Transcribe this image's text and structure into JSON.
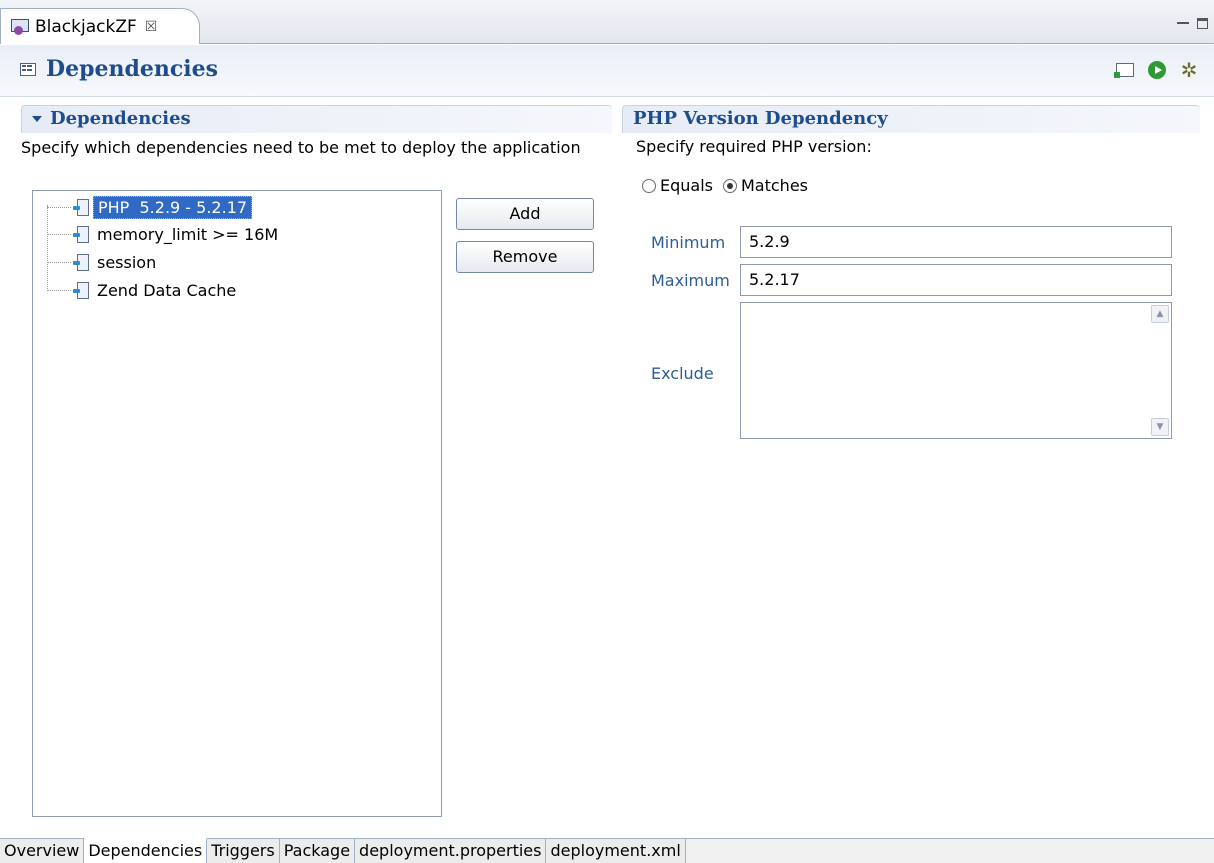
{
  "editor": {
    "tab_title": "BlackjackZF",
    "close_glyph": "☒"
  },
  "form": {
    "title": "Dependencies",
    "actions": [
      "preview-icon",
      "run-icon",
      "debug-icon"
    ]
  },
  "left_section": {
    "title": "Dependencies",
    "description": "Specify which dependencies need to be met to deploy the application",
    "tree_items": [
      "PHP  5.2.9 - 5.2.17",
      "memory_limit >= 16M",
      "session",
      "Zend Data Cache"
    ],
    "selected_index": 0,
    "buttons": {
      "add": "Add",
      "remove": "Remove"
    }
  },
  "right_section": {
    "title": "PHP Version Dependency",
    "description": "Specify required PHP version:",
    "radio_equals": "Equals",
    "radio_matches": "Matches",
    "selected_radio": "Matches",
    "minimum_label": "Minimum",
    "minimum_value": "5.2.9",
    "maximum_label": "Maximum",
    "maximum_value": "5.2.17",
    "exclude_label": "Exclude",
    "exclude_value": ""
  },
  "page_tabs": [
    "Overview",
    "Dependencies",
    "Triggers",
    "Package",
    "deployment.properties",
    "deployment.xml"
  ],
  "active_page_tab": "Dependencies",
  "colors": {
    "section_title": "#1f4c8c",
    "field_label": "#2c5d96",
    "selection": "#316ac5"
  }
}
